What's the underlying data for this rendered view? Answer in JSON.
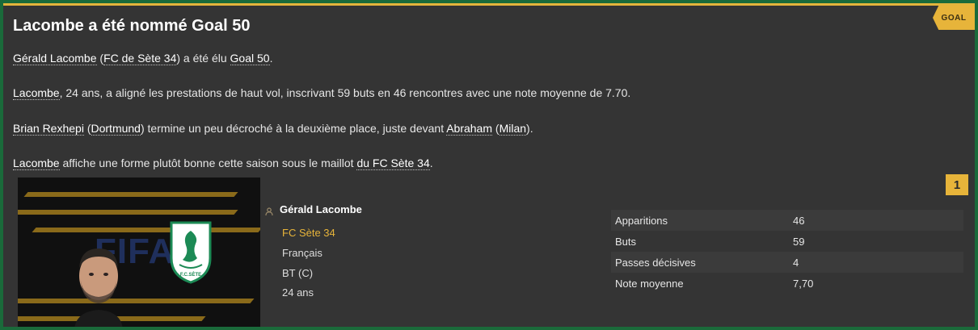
{
  "title": "Lacombe a été nommé Goal 50",
  "badge": "GOAL",
  "paragraph1": {
    "player": "Gérald Lacombe",
    "open": " (",
    "club": "FC de Sète 34",
    "close": ") a été élu ",
    "award": "Goal 50",
    "end": "."
  },
  "paragraph2": {
    "player": "Lacombe",
    "text": ", 24 ans, a aligné les prestations de haut vol, inscrivant 59 buts en 46 rencontres avec une note moyenne de 7.70."
  },
  "paragraph3": {
    "player": "Brian Rexhepi",
    "open1": " (",
    "club1": "Dortmund",
    "mid": ") termine un peu décroché à la deuxième place, juste devant ",
    "player2": "Abraham",
    "open2": " (",
    "club2": "Milan",
    "end": ")."
  },
  "paragraph4": {
    "player": "Lacombe",
    "text": " affiche une forme plutôt bonne cette saison sous le maillot ",
    "club": "du FC Sète 34",
    "end": "."
  },
  "rank": "1",
  "card": {
    "fifa_text": "FIFA",
    "logo_text": "F.C.SÈTE",
    "name": "Gérald Lacombe",
    "club": "FC Sète 34",
    "nationality": "Français",
    "position": "BT (C)",
    "age": "24 ans"
  },
  "stats": [
    {
      "label": "Apparitions",
      "value": "46"
    },
    {
      "label": "Buts",
      "value": "59"
    },
    {
      "label": "Passes décisives",
      "value": "4"
    },
    {
      "label": "Note moyenne",
      "value": "7,70"
    }
  ],
  "colors": {
    "accent": "#e7b43a",
    "frame": "#1a6a3a",
    "panel": "#343434"
  }
}
